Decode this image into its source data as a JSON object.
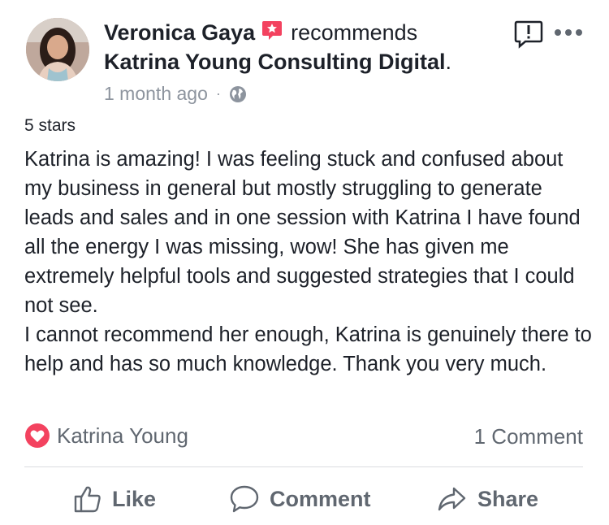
{
  "post": {
    "author": "Veronica Gaya",
    "action": "recommends",
    "page": "Katrina Young Consulting Digital",
    "page_suffix": ".",
    "time": "1 month ago",
    "separator": "·",
    "rating": "5 stars",
    "text": "Katrina is amazing! I was feeling stuck and confused about my business in general but mostly struggling to generate leads and sales and in one session with Katrina I have found all the energy I was missing, wow! She has given me extremely helpful tools and suggested strategies that I could not see.\nI cannot recommend her enough, Katrina is genuinely there to help and has so much knowledge. Thank you very much."
  },
  "reactions": {
    "icon": "heart-icon",
    "name": "Katrina Young",
    "comment_count": "1 Comment"
  },
  "actions": {
    "like": "Like",
    "comment": "Comment",
    "share": "Share"
  },
  "colors": {
    "recommend_badge": "#f3425f",
    "heart": "#f3425f",
    "text": "#1d2129",
    "muted": "#8d949e",
    "action_text": "#606770",
    "divider": "#dadde1"
  }
}
